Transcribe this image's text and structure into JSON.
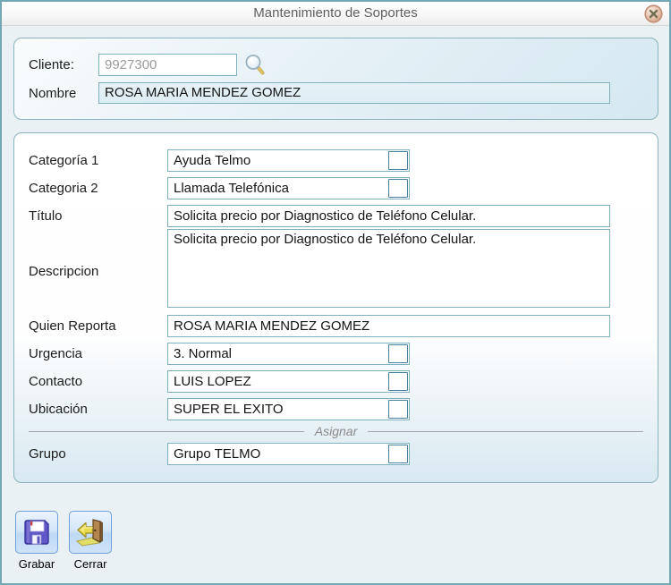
{
  "window": {
    "title": "Mantenimiento de Soportes"
  },
  "client_panel": {
    "cliente_label": "Cliente:",
    "cliente_value": "9927300",
    "nombre_label": "Nombre",
    "nombre_value": "ROSA MARIA MENDEZ GOMEZ"
  },
  "form": {
    "categoria1": {
      "label": "Categoría 1",
      "value": "Ayuda Telmo"
    },
    "categoria2": {
      "label": "Categoria 2",
      "value": "Llamada Telefónica"
    },
    "titulo": {
      "label": "Título",
      "value": "Solicita precio por Diagnostico de Teléfono Celular."
    },
    "descripcion": {
      "label": "Descripcion",
      "value": "Solicita precio por Diagnostico de Teléfono Celular."
    },
    "quien_reporta": {
      "label": "Quien Reporta",
      "value": "ROSA MARIA MENDEZ GOMEZ"
    },
    "urgencia": {
      "label": "Urgencia",
      "value": "3. Normal"
    },
    "contacto": {
      "label": "Contacto",
      "value": "LUIS LOPEZ"
    },
    "ubicacion": {
      "label": "Ubicación",
      "value": "SUPER EL EXITO"
    },
    "asignar_divider": "Asignar",
    "grupo": {
      "label": "Grupo",
      "value": "Grupo TELMO"
    }
  },
  "actions": {
    "grabar_label": "Grabar",
    "cerrar_label": "Cerrar"
  },
  "icons": {
    "close": "close-icon",
    "search": "search-icon",
    "save": "floppy-disk-icon",
    "exit": "exit-door-icon"
  },
  "colors": {
    "dialog_border": "#73a7b4",
    "panel_border": "#8ab4bd",
    "input_border": "#7fb0bd",
    "dropdown_button_top": "#96c2d8",
    "dropdown_button_bottom": "#275f83",
    "action_button_border": "#6f9fd8",
    "close_button_rim": "#c08e74",
    "title_text": "#5f5f5f"
  }
}
